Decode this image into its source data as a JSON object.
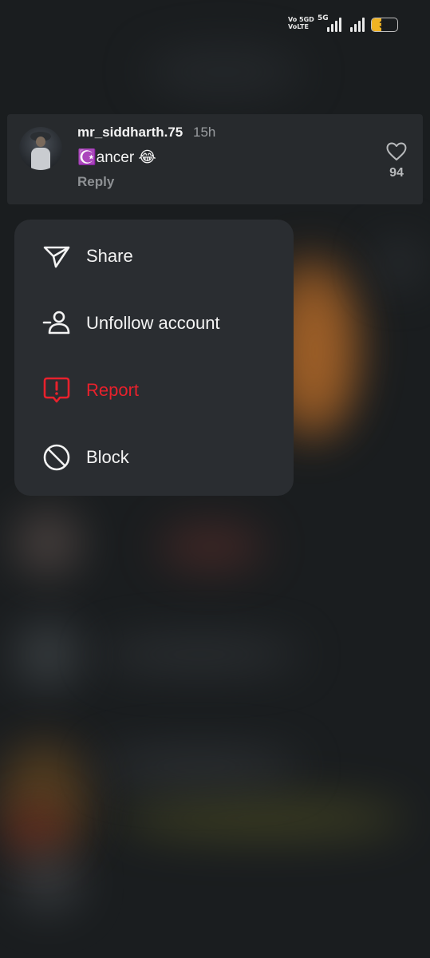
{
  "status_bar": {
    "network_label_1": "Vo 5GD",
    "network_label_2": "VoLTE",
    "network_type": "5G",
    "battery_level": 38,
    "battery_text": "38",
    "battery_color": "#f0b323"
  },
  "comment": {
    "username": "mr_siddharth.75",
    "time": "15h",
    "text": "☪️ancer 😂",
    "reply_label": "Reply",
    "like_count": "94",
    "like_icon": "heart-outline-icon"
  },
  "menu": {
    "items": [
      {
        "label": "Share",
        "icon": "paper-plane-icon",
        "color": "#f3f3f3"
      },
      {
        "label": "Unfollow account",
        "icon": "person-minus-icon",
        "color": "#f3f3f3"
      },
      {
        "label": "Report",
        "icon": "report-exclamation-icon",
        "color": "#e8212c"
      },
      {
        "label": "Block",
        "icon": "block-circle-icon",
        "color": "#f3f3f3"
      }
    ]
  }
}
